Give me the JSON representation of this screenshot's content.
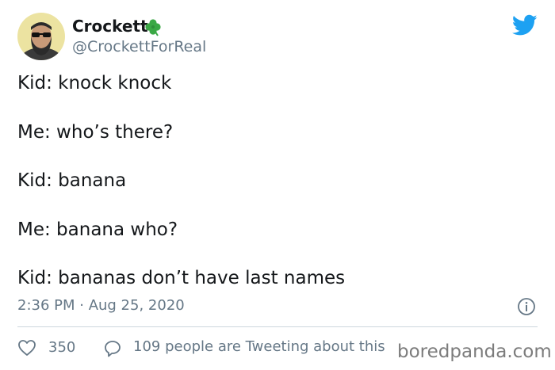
{
  "author": {
    "name": "Crockett",
    "handle": "@CrockettForReal",
    "badge_icon": "shamrock-icon",
    "badge_color": "#3aa845"
  },
  "brand_icon": "twitter-bird-icon",
  "brand_color": "#1da1f2",
  "tweet_lines": [
    "Kid: knock knock",
    "Me: who’s there?",
    "Kid: banana",
    "Me: banana who?",
    "Kid: bananas don’t have last names"
  ],
  "timestamp": "2:36 PM · Aug 25, 2020",
  "info_icon": "info-icon",
  "stats": {
    "likes": "350",
    "tweeting_text": "109 people are Tweeting about this"
  },
  "watermark": "boredpanda.com"
}
